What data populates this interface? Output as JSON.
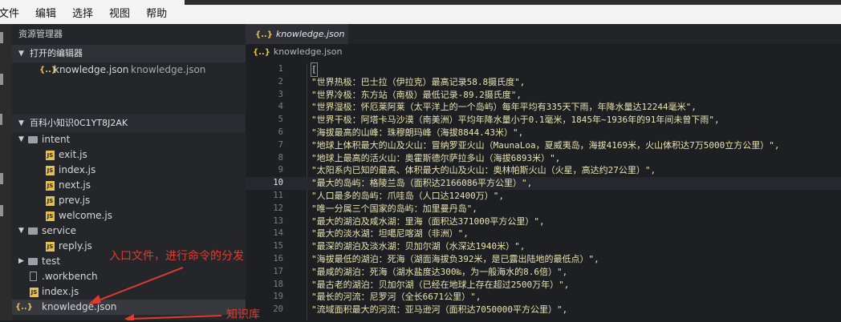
{
  "menu": [
    "文件",
    "编辑",
    "选择",
    "视图",
    "帮助"
  ],
  "sidebar": {
    "title": "资源管理器",
    "open_editors_label": "打开的编辑器",
    "open_editor_item": {
      "name": "knowledge.json",
      "path": "knowledge.json"
    },
    "project_label": "百科小知识0C1YT8J2AK",
    "tree": [
      {
        "name": "intent",
        "type": "folder"
      },
      {
        "name": "exit.js",
        "type": "js"
      },
      {
        "name": "index.js",
        "type": "js"
      },
      {
        "name": "next.js",
        "type": "js"
      },
      {
        "name": "prev.js",
        "type": "js"
      },
      {
        "name": "welcome.js",
        "type": "js"
      },
      {
        "name": "service",
        "type": "folder"
      },
      {
        "name": "reply.js",
        "type": "js"
      },
      {
        "name": "test",
        "type": "folder"
      },
      {
        "name": ".workbench",
        "type": "file"
      },
      {
        "name": "index.js",
        "type": "js"
      },
      {
        "name": "knowledge.json",
        "type": "json"
      }
    ]
  },
  "editor": {
    "tab_label": "knowledge.json",
    "breadcrumb": "knowledge.json",
    "json_glyph": "{..}",
    "js_glyph": "JS",
    "current_line": 10,
    "lines": [
      {
        "n": "1",
        "text": "["
      },
      {
        "n": "2",
        "text": "\"世界热极：巴士拉（伊拉克）最高记录58.8摄氏度\","
      },
      {
        "n": "3",
        "text": "\"世界冷极：东方站（南极）最低记录-89.2摄氏度\","
      },
      {
        "n": "4",
        "text": "\"世界湿极：怀厄莱阿莱（太平洋上的一个岛屿）每年平均有335天下雨，年降水量达12244毫米\","
      },
      {
        "n": "5",
        "text": "\"世界干极：阿塔卡马沙漠（南美洲）平均年降水量小于0.1毫米，1845年~1936年的91年间未曾下雨\","
      },
      {
        "n": "6",
        "text": "\"海拔最高的山峰：珠穆朗玛峰（海拔8844.43米）\","
      },
      {
        "n": "7",
        "text": "\"地球上体积最大的山及火山：冒纳罗亚火山（MaunaLoa，夏威夷岛，海拔4169米，火山体积达7万5000立方公里）\","
      },
      {
        "n": "8",
        "text": "\"地球上最高的活火山：奥霍斯德尔萨拉多山（海拔6893米）\","
      },
      {
        "n": "9",
        "text": "\"太阳系内已知的最高、体积最大的山及火山：奥林帕斯火山（火星，高达约27公里）\","
      },
      {
        "n": "10",
        "text": "\"最大的岛屿：格陵兰岛（面积达2166086平方公里）\","
      },
      {
        "n": "11",
        "text": "\"人口最多的岛屿：爪哇岛（人口达12400万）\","
      },
      {
        "n": "12",
        "text": "\"唯一分属三个国家的岛屿：加里曼丹岛\","
      },
      {
        "n": "13",
        "text": "\"最大的湖泊及咸水湖：里海（面积达371000平方公里）\","
      },
      {
        "n": "14",
        "text": "\"最大的淡水湖：坦噶尼喀湖（非洲）\","
      },
      {
        "n": "15",
        "text": "\"最深的湖泊及淡水湖：贝加尔湖（水深达1940米）\","
      },
      {
        "n": "16",
        "text": "\"海拔最低的湖泊：死海（湖面海拔负392米，是已露出陆地的最低点）\","
      },
      {
        "n": "17",
        "text": "\"最咸的湖泊：死海（湖水盐度达300‰，为一般海水的8.6倍）\","
      },
      {
        "n": "18",
        "text": "\"最古老的湖泊：贝加尔湖（已经在地球上存在超过2500万年）\","
      },
      {
        "n": "19",
        "text": "\"最长的河流：尼罗河（全长6671公里）\","
      },
      {
        "n": "20",
        "text": "\"流域面积最大的河流：亚马逊河（面积达7050000平方公里）\","
      }
    ]
  },
  "annotations": {
    "entry": "入口文件，进行命令的分发",
    "knowledge": "知识库"
  },
  "colors": {
    "annotation": "#e23b2e",
    "string": "#e9e3b0"
  }
}
